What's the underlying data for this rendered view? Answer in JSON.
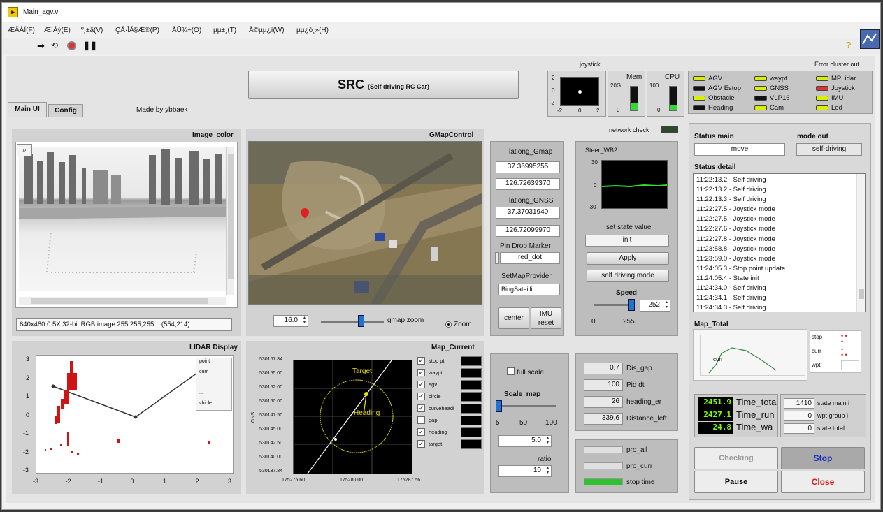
{
  "window": {
    "title": "Main_agv.vi"
  },
  "menu": [
    "ÆÄÀÏ(F)",
    "ÆíÁý(E)",
    "º¸±â(V)",
    "ÇÁ·ÎÁ§Æ®(P)",
    "ÀÛ¾÷(O)",
    "µµ±¸(T)",
    "À©µµ¿ì(W)",
    "µµ¿ò¸»(H)"
  ],
  "app": {
    "title": "SRC",
    "subtitle": "(Self driving RC Car)",
    "made_by": "Made by ybbaek"
  },
  "tabs": [
    "Main UI",
    "Config"
  ],
  "joystick": {
    "label": "joystick",
    "x_ticks": [
      "-2",
      "0",
      "2"
    ],
    "y_ticks": [
      "2",
      "0",
      "-2"
    ],
    "position": [
      0.0,
      0.0
    ]
  },
  "mem": {
    "label": "Mem",
    "ticks": [
      "20G",
      "0"
    ],
    "level": 0.3
  },
  "cpu": {
    "label": "CPU",
    "ticks": [
      "100",
      "0"
    ],
    "level": 0.25
  },
  "error_cluster": {
    "label": "Error cluster out"
  },
  "leds": [
    {
      "label": "AGV",
      "color": "#d8f000"
    },
    {
      "label": "AGV Estop",
      "color": "#111111"
    },
    {
      "label": "Obstacle",
      "color": "#d8f000"
    },
    {
      "label": "Heading",
      "color": "#111111"
    },
    {
      "label": "waypt",
      "color": "#d8f000"
    },
    {
      "label": "GNSS",
      "color": "#d8f000"
    },
    {
      "label": "VLP16",
      "color": "#111111"
    },
    {
      "label": "Cam",
      "color": "#d8f000"
    },
    {
      "label": "MPLidar",
      "color": "#d8f000"
    },
    {
      "label": "Joystick",
      "color": "#e03030"
    },
    {
      "label": "IMU",
      "color": "#d8f000"
    },
    {
      "label": "Led",
      "color": "#d8f000"
    }
  ],
  "image_color": {
    "label": "Image_color",
    "info": "640x480 0.5X 32-bit RGB image 255,255,255",
    "coords": "(554,214)"
  },
  "gmap": {
    "label": "GMapControl",
    "zoom_value": "16.0",
    "zoom_label": "gmap zoom",
    "zoom_fraction": 0.65,
    "zoom_radio": "Zoom"
  },
  "latlong": {
    "gmap_label": "latlong_Gmap",
    "gmap_lat": "37.36995255",
    "gmap_lon": "126.72639370",
    "gnss_label": "latlong_GNSS",
    "gnss_lat": "37.37031940",
    "gnss_lon": "126.72099970",
    "pin_label": "Pin Drop Marker",
    "pin_value": "red_dot",
    "provider_label": "SetMapProvider",
    "provider_value": "BingSateilli",
    "center_btn": "center",
    "imu_btn": "IMU reset"
  },
  "network": {
    "label": "network check"
  },
  "steer": {
    "label": "Steer_WB2",
    "y_ticks": [
      "30",
      "0",
      "-30"
    ]
  },
  "state_ctrl": {
    "label": "set state value",
    "value": "init",
    "apply_btn": "Apply",
    "self_btn": "self driving mode",
    "speed_label": "Speed",
    "speed_value": "252",
    "speed_min": "0",
    "speed_max": "255",
    "speed_fraction": 0.988
  },
  "status": {
    "main_label": "Status main",
    "main_value": "move",
    "mode_label": "mode out",
    "mode_value": "self-driving",
    "detail_label": "Status detail",
    "detail": [
      "11:22:13.2 - Self driving",
      "11:22:13.2 - Self driving",
      "11:22:13.3 - Self driving",
      "11:22:27.5 - Joystick mode",
      "11:22:27.5 - Joystick mode",
      "11:22:27.6 - Joystick mode",
      "11:22:27.8 - Joystick mode",
      "11:23:58.8 - Joystick mode",
      "11:23:59.0 - Joystick mode",
      "11:24:05.3 - Stop point update",
      "11:24:05.4 - State init",
      "11:24:34.0 - Self driving",
      "11:24:34.1 - Self driving",
      "11:24:34.3 - Self driving"
    ]
  },
  "map_total": {
    "label": "Map_Total",
    "marker": "curr",
    "legend": [
      "stop",
      "curr",
      "wpt"
    ]
  },
  "lidar": {
    "label": "LIDAR Display",
    "x_ticks": [
      "-3",
      "-2",
      "-1",
      "0",
      "1",
      "2",
      "3"
    ],
    "y_ticks": [
      "3",
      "2",
      "1",
      "0",
      "-1",
      "-2",
      "-3"
    ],
    "legend": [
      "point",
      "curr",
      "...",
      "...",
      "vhicle"
    ]
  },
  "map_current": {
    "label": "Map_Current",
    "y_ticks": [
      "530157.84",
      "530155.00",
      "530152.00",
      "530150.00",
      "530147.50",
      "530145.00",
      "530142.50",
      "530140.00",
      "530137.84"
    ],
    "x_ticks": [
      "175275.60",
      "175280.00",
      "175287.56"
    ],
    "ylabel": "GNS",
    "target_label": "Target",
    "heading_label": "Heading",
    "legend": [
      {
        "label": "stop pt",
        "checked": true
      },
      {
        "label": "waypt",
        "checked": true
      },
      {
        "label": "egv",
        "checked": true
      },
      {
        "label": "circle",
        "checked": true
      },
      {
        "label": "curveheadi",
        "checked": true
      },
      {
        "label": "gap",
        "checked": false
      },
      {
        "label": "heading",
        "checked": true
      },
      {
        "label": "target",
        "checked": true
      }
    ]
  },
  "scale": {
    "fullscale_label": "full scale",
    "scale_label": "Scale_map",
    "ticks": [
      "5",
      "50",
      "100"
    ],
    "scale_fraction": 0.0,
    "scale_value": "5.0",
    "ratio_label": "ratio",
    "ratio_value": "10"
  },
  "params": [
    {
      "value": "0.7",
      "label": "Dis_gap"
    },
    {
      "value": "100",
      "label": "Pid dt"
    },
    {
      "value": "26",
      "label": "heading_er"
    },
    {
      "value": "339.6",
      "label": "Distance_left"
    }
  ],
  "progress": [
    {
      "label": "pro_all",
      "fraction": 0.0
    },
    {
      "label": "pro_curr",
      "fraction": 0.0
    },
    {
      "label": "stop time",
      "fraction": 1.0
    }
  ],
  "times": [
    {
      "value": "2451.9",
      "label": "Time_tota"
    },
    {
      "value": "2427.1",
      "label": "Time_run"
    },
    {
      "value": "24.8",
      "label": "Time_wa"
    }
  ],
  "counters": [
    {
      "value": "1410",
      "label": "state main i"
    },
    {
      "value": "0",
      "label": "wpt group i"
    },
    {
      "value": "0",
      "label": "state total i"
    }
  ],
  "buttons": {
    "checking": "Checking",
    "stop": "Stop",
    "pause": "Pause",
    "close": "Close"
  },
  "colors": {
    "panel": "#d2d2d2",
    "led_on": "#d8f000",
    "plot_green": "#30e030",
    "stop_blue": "#1a2ac0",
    "close_red": "#e01818"
  }
}
